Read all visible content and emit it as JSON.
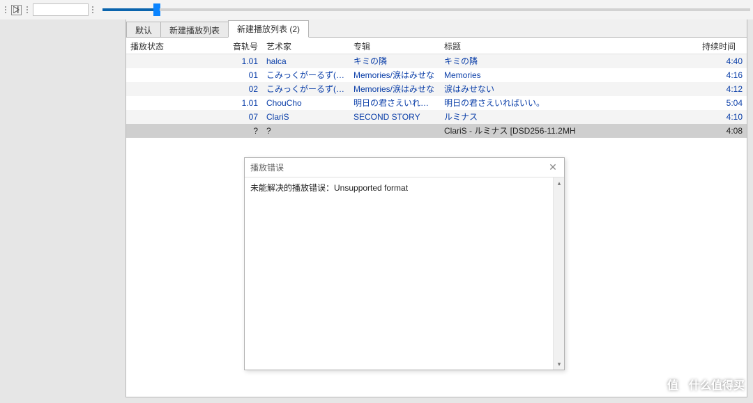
{
  "tabs": [
    {
      "label": "默认",
      "active": false
    },
    {
      "label": "新建播放列表",
      "active": false
    },
    {
      "label": "新建播放列表 (2)",
      "active": true
    }
  ],
  "columns": {
    "status": "播放状态",
    "track": "音轨号",
    "artist": "艺术家",
    "album": "专辑",
    "title": "标题",
    "duration": "持续时间"
  },
  "rows": [
    {
      "status": "",
      "track": "1.01",
      "artist": "halca",
      "album": "キミの隣",
      "title": "キミの隣",
      "duration": "4:40",
      "selected": false
    },
    {
      "status": "",
      "track": "01",
      "artist": "こみっくがーるず(赤...",
      "album": "Memories/涙はみせな",
      "title": "Memories",
      "duration": "4:16",
      "selected": false
    },
    {
      "status": "",
      "track": "02",
      "artist": "こみっくがーるず(赤...",
      "album": "Memories/涙はみせな",
      "title": "涙はみせない",
      "duration": "4:12",
      "selected": false
    },
    {
      "status": "",
      "track": "1.01",
      "artist": "ChouCho",
      "album": "明日の君さえいればい",
      "title": "明日の君さえいればいい。",
      "duration": "5:04",
      "selected": false
    },
    {
      "status": "",
      "track": "07",
      "artist": "ClariS",
      "album": "SECOND STORY",
      "title": "ルミナス",
      "duration": "4:10",
      "selected": false
    },
    {
      "status": "",
      "track": "?",
      "artist": "?",
      "album": "",
      "title": "ClariS - ルミナス [DSD256-11.2MH",
      "duration": "4:08",
      "selected": true
    }
  ],
  "dialog": {
    "title": "播放错误",
    "message": "未能解决的播放错误：Unsupported format"
  },
  "watermark": {
    "badge": "值",
    "text": "什么值得买"
  }
}
